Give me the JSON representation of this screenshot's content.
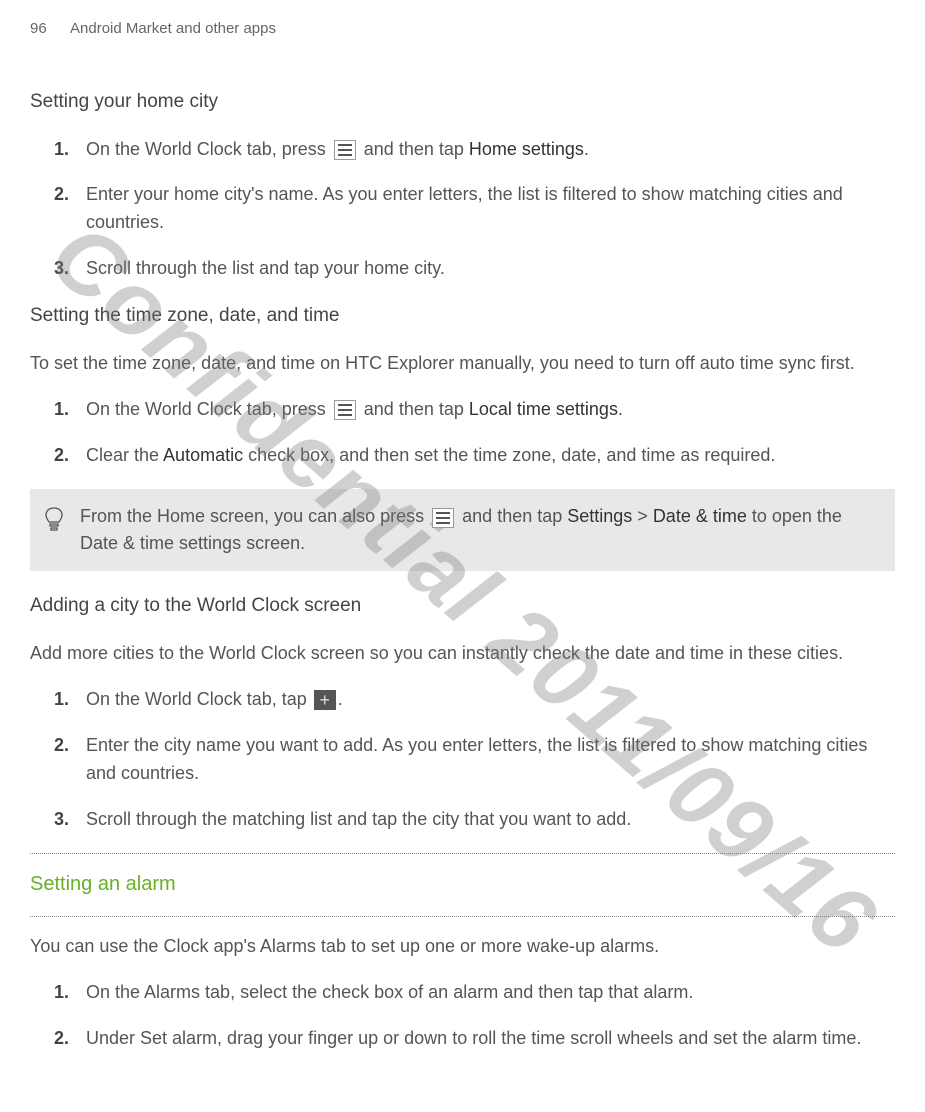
{
  "header": {
    "page_number": "96",
    "chapter": "Android Market and other apps"
  },
  "watermark": "Confidential   2011/09/16",
  "sections": {
    "s1": {
      "heading": "Setting your home city",
      "steps": {
        "n1": "1.",
        "t1a": "On the World Clock tab, press ",
        "t1b": " and then tap ",
        "t1c": "Home settings",
        "t1d": ".",
        "n2": "2.",
        "t2": "Enter your home city's name. As you enter letters, the list is filtered to show matching cities and countries.",
        "n3": "3.",
        "t3": "Scroll through the list and tap your home city."
      }
    },
    "s2": {
      "heading": "Setting the time zone, date, and time",
      "intro": "To set the time zone, date, and time on HTC Explorer manually, you need to turn off auto time sync first.",
      "steps": {
        "n1": "1.",
        "t1a": "On the World Clock tab, press ",
        "t1b": " and then tap ",
        "t1c": "Local time settings",
        "t1d": ".",
        "n2": "2.",
        "t2a": "Clear the ",
        "t2b": "Automatic",
        "t2c": " check box, and then set the time zone, date, and time as required."
      }
    },
    "tip": {
      "t1": "From the Home screen, you can also press ",
      "t2": " and then tap ",
      "t3": "Settings",
      "t4": " > ",
      "t5": "Date & time",
      "t6": " to open the Date & time settings screen."
    },
    "s3": {
      "heading": "Adding a city to the World Clock screen",
      "intro": "Add more cities to the World Clock screen so you can instantly check the date and time in these cities.",
      "steps": {
        "n1": "1.",
        "t1a": "On the World Clock tab, tap ",
        "t1b": ".",
        "n2": "2.",
        "t2": "Enter the city name you want to add. As you enter letters, the list is filtered to show matching cities and countries.",
        "n3": "3.",
        "t3": "Scroll through the matching list and tap the city that you want to add."
      }
    },
    "s4": {
      "heading": "Setting an alarm",
      "intro": "You can use the Clock app's Alarms tab to set up one or more wake-up alarms.",
      "steps": {
        "n1": "1.",
        "t1": "On the Alarms tab, select the check box of an alarm and then tap that alarm.",
        "n2": "2.",
        "t2": "Under Set alarm, drag your finger up or down to roll the time scroll wheels and set the alarm time."
      }
    }
  }
}
